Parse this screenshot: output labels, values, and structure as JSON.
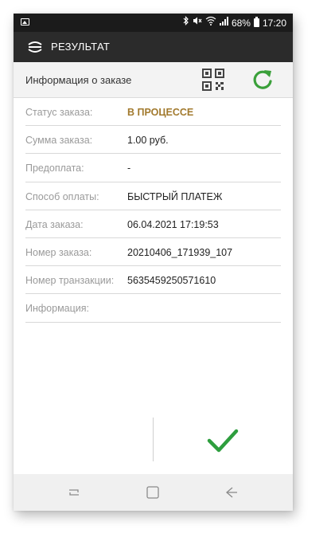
{
  "status_bar": {
    "battery": "68%",
    "time": "17:20",
    "icons": [
      "gallery-icon",
      "bluetooth-icon",
      "mute-icon",
      "wifi-icon",
      "signal-icon",
      "battery-icon"
    ]
  },
  "app_bar": {
    "logo_icon": "app-logo-icon",
    "title": "РЕЗУЛЬТАТ"
  },
  "info_header": {
    "title": "Информация о заказе",
    "qr_icon": "qr-code-icon",
    "refresh_icon": "refresh-icon",
    "refresh_color": "#3aa03a"
  },
  "details": [
    {
      "label": "Статус заказа:",
      "value": "В ПРОЦЕССЕ"
    },
    {
      "label": "Сумма заказа:",
      "value": "1.00 руб."
    },
    {
      "label": "Предоплата:",
      "value": "-"
    },
    {
      "label": "Способ оплаты:",
      "value": "БЫСТРЫЙ ПЛАТЕЖ"
    },
    {
      "label": "Дата заказа:",
      "value": "06.04.2021 17:19:53"
    },
    {
      "label": "Номер заказа:",
      "value": "20210406_171939_107"
    },
    {
      "label": "Номер транзакции:",
      "value": "5635459250571610"
    },
    {
      "label": "Информация:",
      "value": ""
    }
  ],
  "colors": {
    "status_accent": "#a27a2e",
    "confirm_check": "#2e9e3e",
    "app_bar": "#2b2b2b"
  },
  "actions": {
    "confirm_icon": "checkmark-icon"
  },
  "nav_bar": {
    "icons": [
      "recent-apps-icon",
      "home-icon",
      "back-icon"
    ]
  }
}
